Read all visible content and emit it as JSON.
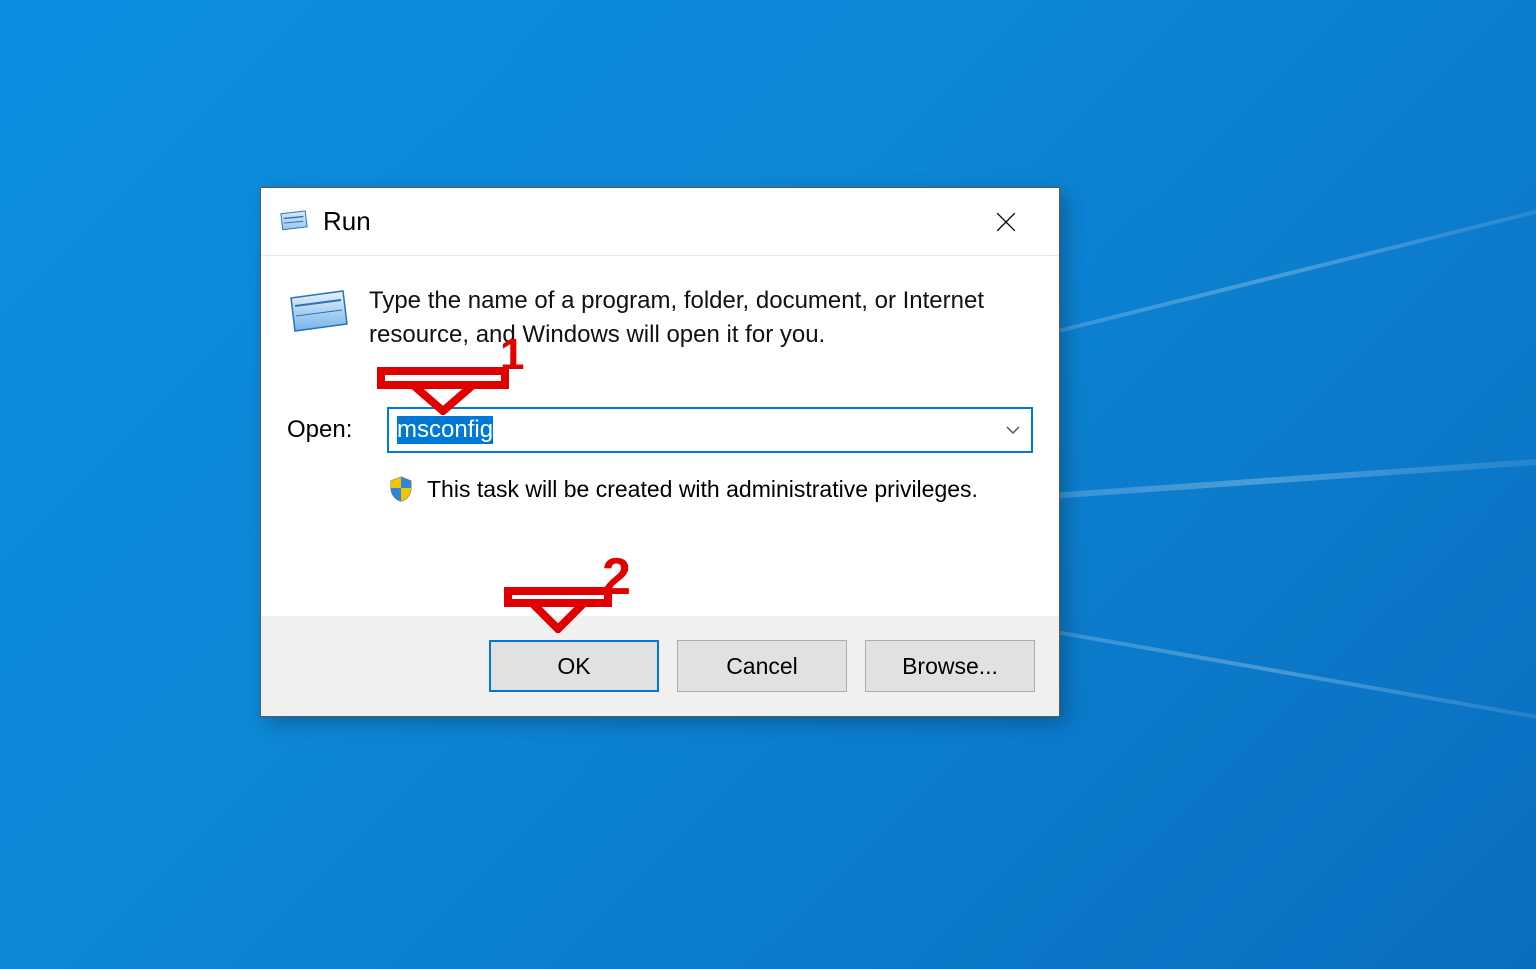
{
  "dialog": {
    "title": "Run",
    "description": "Type the name of a program, folder, document, or Internet resource, and Windows will open it for you.",
    "open_label": "Open:",
    "open_value": "msconfig",
    "admin_note": "This task will be created with administrative privileges.",
    "buttons": {
      "ok": "OK",
      "cancel": "Cancel",
      "browse": "Browse..."
    }
  },
  "annotations": {
    "step1": "1",
    "step2": "2"
  }
}
